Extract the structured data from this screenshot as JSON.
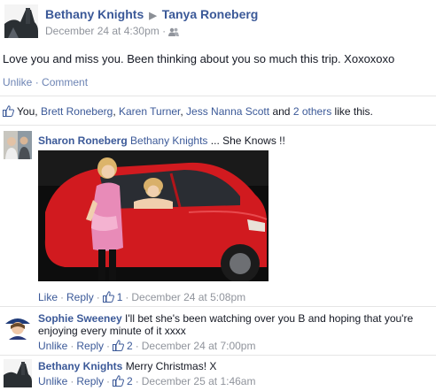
{
  "post": {
    "author": "Bethany Knights",
    "target": "Tanya Roneberg",
    "date": "December 24 at 4:30pm",
    "separator": "·",
    "audience_icon": "friends-icon",
    "text": "Love you and miss you. Been thinking about you so much this trip. Xoxoxoxo",
    "actions": {
      "unlike": "Unlike",
      "sep": "·",
      "comment": "Comment"
    }
  },
  "likes": {
    "you": "You,",
    "names": [
      "Brett Roneberg",
      "Karen Turner",
      "Jess Nanna Scott"
    ],
    "and": "and",
    "others": "2 others",
    "suffix": "like this."
  },
  "comments": [
    {
      "author": "Sharon Roneberg",
      "tag": "Bethany Knights",
      "text": "... She Knows !!",
      "actions": {
        "primary": "Like",
        "reply": "Reply",
        "likes": "1",
        "date": "December 24 at 5:08pm"
      }
    },
    {
      "author": "Sophie Sweeney",
      "text": "I'll bet she's been watching over you B and hoping that you're",
      "text2": "enjoying every minute of it xxxx",
      "actions": {
        "primary": "Unlike",
        "reply": "Reply",
        "likes": "2",
        "date": "December 24 at 7:00pm"
      }
    },
    {
      "author": "Bethany Knights",
      "text": "Merry Christmas! X",
      "actions": {
        "primary": "Unlike",
        "reply": "Reply",
        "likes": "2",
        "date": "December 25 at 1:46am"
      }
    }
  ],
  "colors": {
    "link": "#3b5998",
    "meta": "#90949c",
    "car": "#d11a1f"
  }
}
